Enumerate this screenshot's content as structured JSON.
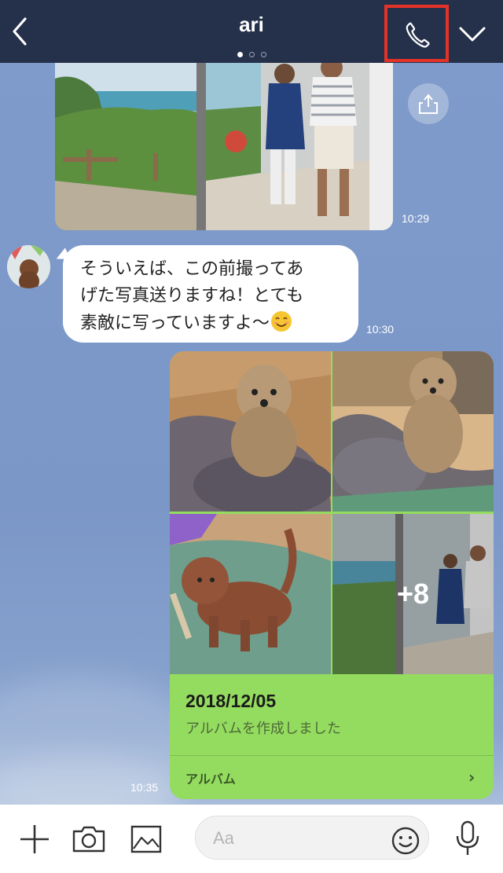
{
  "header": {
    "title": "ari",
    "back_icon": "chevron-left-icon",
    "call_icon": "phone-icon",
    "menu_icon": "chevron-down-icon",
    "page_indicator": {
      "count": 3,
      "active": 0
    }
  },
  "chat": {
    "messages": [
      {
        "type": "photo",
        "sender": "other",
        "time": "10:29",
        "share_icon": "share-icon"
      },
      {
        "type": "text",
        "sender": "other",
        "text": "そういえば、この前撮ってあ\nげた写真送りますね！とても\n素敵に写っていますよ〜",
        "emoji": "smiling-face-emoji",
        "time": "10:30"
      },
      {
        "type": "album",
        "sender": "me",
        "date": "2018/12/05",
        "subtitle": "アルバムを作成しました",
        "more_count": "+8",
        "link_label": "アルバム",
        "time": "10:35"
      }
    ]
  },
  "bottom_bar": {
    "add_icon": "plus-icon",
    "camera_icon": "camera-icon",
    "image_icon": "image-icon",
    "input_placeholder": "Aa",
    "emoji_icon": "emoji-icon",
    "mic_icon": "microphone-icon"
  },
  "colors": {
    "header_bg": "#25304a",
    "chat_bg": "#7b97c7",
    "bubble_in": "#ffffff",
    "bubble_out": "#94dc5f",
    "highlight_border": "#e53228"
  }
}
